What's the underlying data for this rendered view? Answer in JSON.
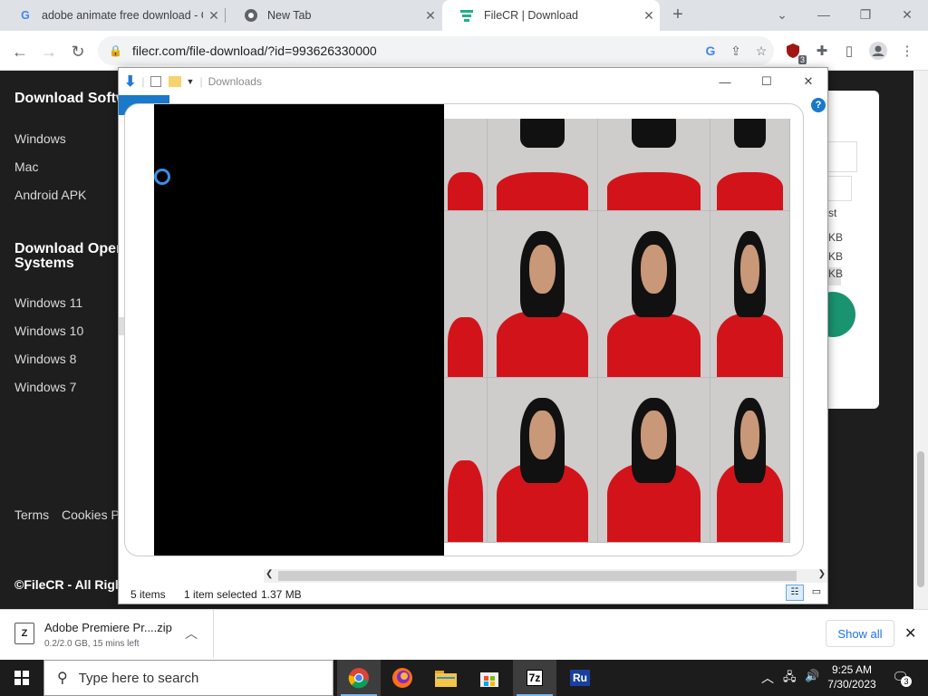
{
  "browser": {
    "tabs": [
      {
        "label": "adobe animate free download - G",
        "icon": "google-g-icon"
      },
      {
        "label": "New Tab",
        "icon": "chrome-icon"
      },
      {
        "label": "FileCR | Download",
        "icon": "filecr-icon"
      }
    ],
    "url": "filecr.com/file-download/?id=993626330000",
    "extension_badge": "3"
  },
  "sidebar": {
    "heading1": "Download Softw",
    "links1": [
      "Windows",
      "Mac",
      "Android APK"
    ],
    "heading2_line1": "Download Oper",
    "heading2_line2": "Systems",
    "links2": [
      "Windows 11",
      "Windows 10",
      "Windows 8",
      "Windows 7"
    ],
    "footer_links": [
      "Terms",
      "Cookies P"
    ],
    "copyright": "©FileCR - All Rights"
  },
  "background_sizes": [
    "st",
    "KB",
    "KB",
    "KB",
    "KB"
  ],
  "explorer": {
    "title": "Downloads",
    "status_items": "5 items",
    "status_selected": "1 item selected",
    "status_size": "1.37 MB"
  },
  "download": {
    "filename": "Adobe Premiere Pr....zip",
    "progress": "0.2/2.0 GB, 15 mins left",
    "show_all": "Show all"
  },
  "taskbar": {
    "search_placeholder": "Type here to search",
    "time": "9:25 AM",
    "date": "7/30/2023",
    "notifications": "3",
    "apps": [
      "chrome",
      "firefox",
      "file-explorer",
      "store",
      "7zip",
      "ru"
    ]
  },
  "colors": {
    "chrome_tabstrip": "#dee1e6",
    "page_bg": "#1e1e1e",
    "accent_blue": "#1a73e8",
    "shirt_red": "#d2141a",
    "green_button": "#1a9470"
  }
}
